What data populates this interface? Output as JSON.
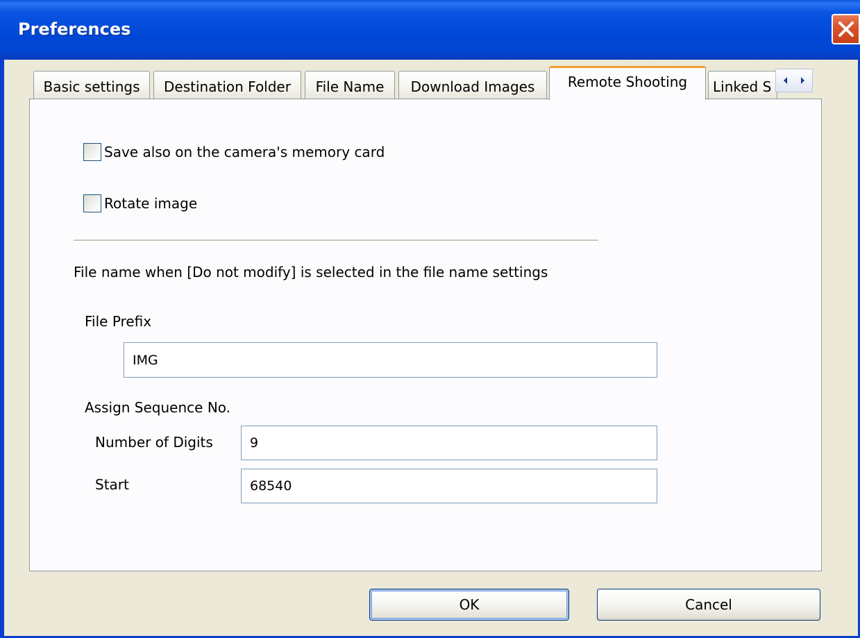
{
  "window": {
    "title": "Preferences"
  },
  "tabs": [
    {
      "label": "Basic settings",
      "active": false
    },
    {
      "label": "Destination Folder",
      "active": false
    },
    {
      "label": "File Name",
      "active": false
    },
    {
      "label": "Download Images",
      "active": false
    },
    {
      "label": "Remote Shooting",
      "active": true
    },
    {
      "label": "Linked S",
      "active": false
    }
  ],
  "remote_shooting": {
    "save_on_card": {
      "label": "Save also on the camera's memory card",
      "checked": false
    },
    "rotate_image": {
      "label": "Rotate image",
      "checked": false
    },
    "section_title": "File name when [Do not modify] is selected in the file name settings",
    "file_prefix": {
      "label": "File Prefix",
      "value": "IMG"
    },
    "sequence": {
      "label": "Assign Sequence No.",
      "digits": {
        "label": "Number of Digits",
        "value": "9"
      },
      "start": {
        "label": "Start",
        "value": "68540"
      }
    }
  },
  "buttons": {
    "ok": "OK",
    "cancel": "Cancel"
  },
  "colors": {
    "titlebar": "#0047d6",
    "active_tab_accent": "#f0a030",
    "close_button": "#d8542a"
  }
}
